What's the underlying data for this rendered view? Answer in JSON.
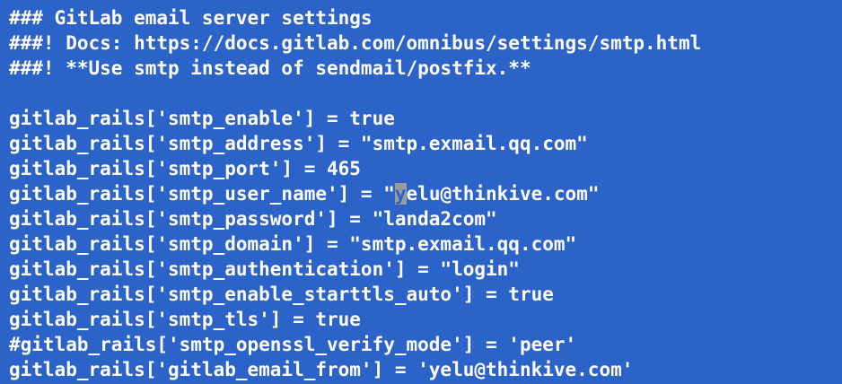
{
  "terminal": {
    "background_color": "#2c63c8",
    "text_color": "#ffffff",
    "cursor_color": "#9b9b9b",
    "lines": [
      "### GitLab email server settings",
      "###! Docs: https://docs.gitlab.com/omnibus/settings/smtp.html",
      "###! **Use smtp instead of sendmail/postfix.**",
      "",
      "gitlab_rails['smtp_enable'] = true",
      "gitlab_rails['smtp_address'] = \"smtp.exmail.qq.com\"",
      "gitlab_rails['smtp_port'] = 465",
      "gitlab_rails['smtp_user_name'] = \"yelu@thinkive.com\"",
      "gitlab_rails['smtp_password'] = \"landa2com\"",
      "gitlab_rails['smtp_domain'] = \"smtp.exmail.qq.com\"",
      "gitlab_rails['smtp_authentication'] = \"login\"",
      "gitlab_rails['smtp_enable_starttls_auto'] = true",
      "gitlab_rails['smtp_tls'] = true",
      "#gitlab_rails['smtp_openssl_verify_mode'] = 'peer'",
      "gitlab_rails['gitlab_email_from'] = 'yelu@thinkive.com'"
    ],
    "cursor_line_parts": {
      "before": "gitlab_rails['smtp_user_name'] = \"",
      "cursor_char": "y",
      "after": "elu@thinkive.com\""
    }
  }
}
